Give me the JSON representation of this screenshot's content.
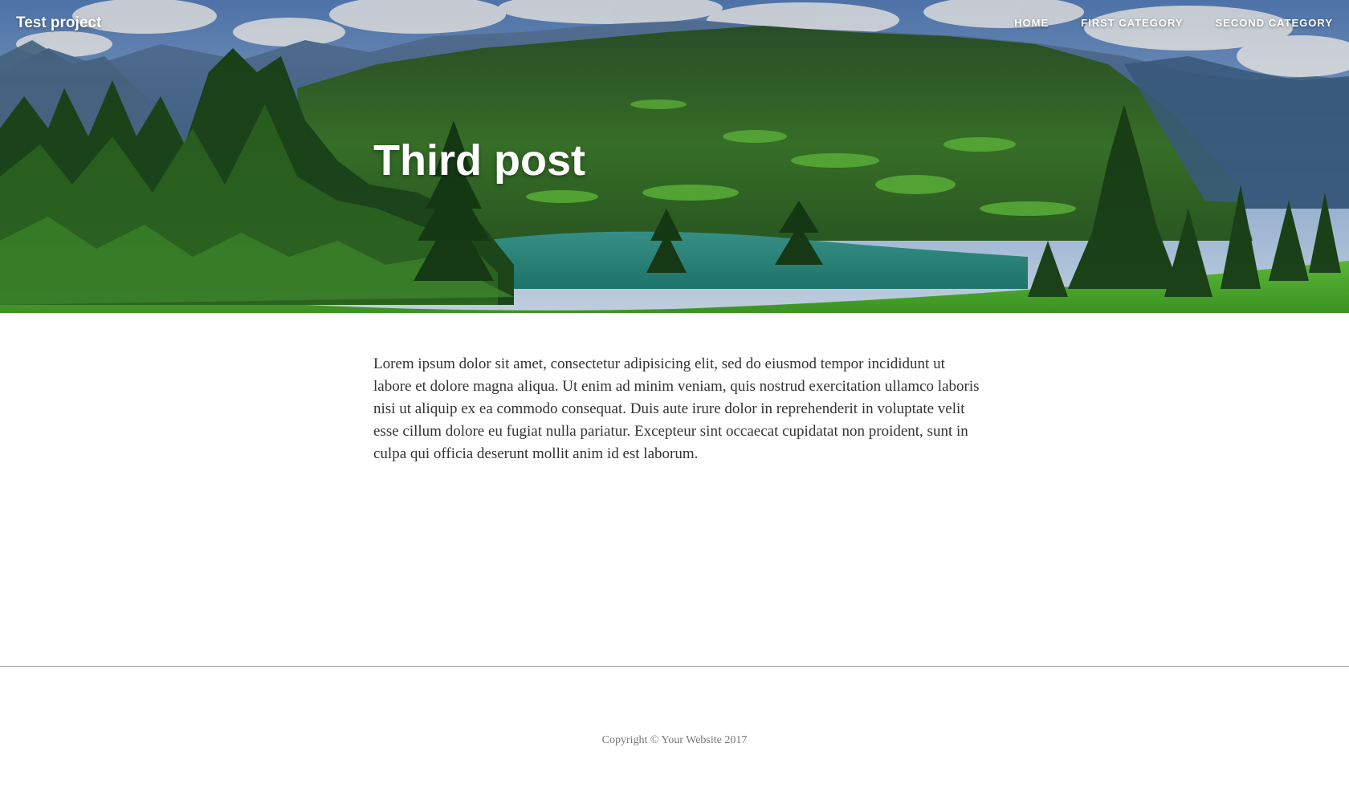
{
  "navbar": {
    "brand": "Test project",
    "links": [
      "Home",
      "First Category",
      "Second Category"
    ]
  },
  "hero": {
    "title": "Third post",
    "image": "mountain-lake-landscape"
  },
  "article": {
    "body": "Lorem ipsum dolor sit amet, consectetur adipisicing elit, sed do eiusmod tempor incididunt ut labore et dolore magna aliqua. Ut enim ad minim veniam, quis nostrud exercitation ullamco laboris nisi ut aliquip ex ea commodo consequat. Duis aute irure dolor in reprehenderit in voluptate velit esse cillum dolore eu fugiat nulla pariatur. Excepteur sint occaecat cupidatat non proident, sunt in culpa qui officia deserunt mollit anim id est laborum."
  },
  "footer": {
    "copyright": "Copyright © Your Website 2017"
  }
}
